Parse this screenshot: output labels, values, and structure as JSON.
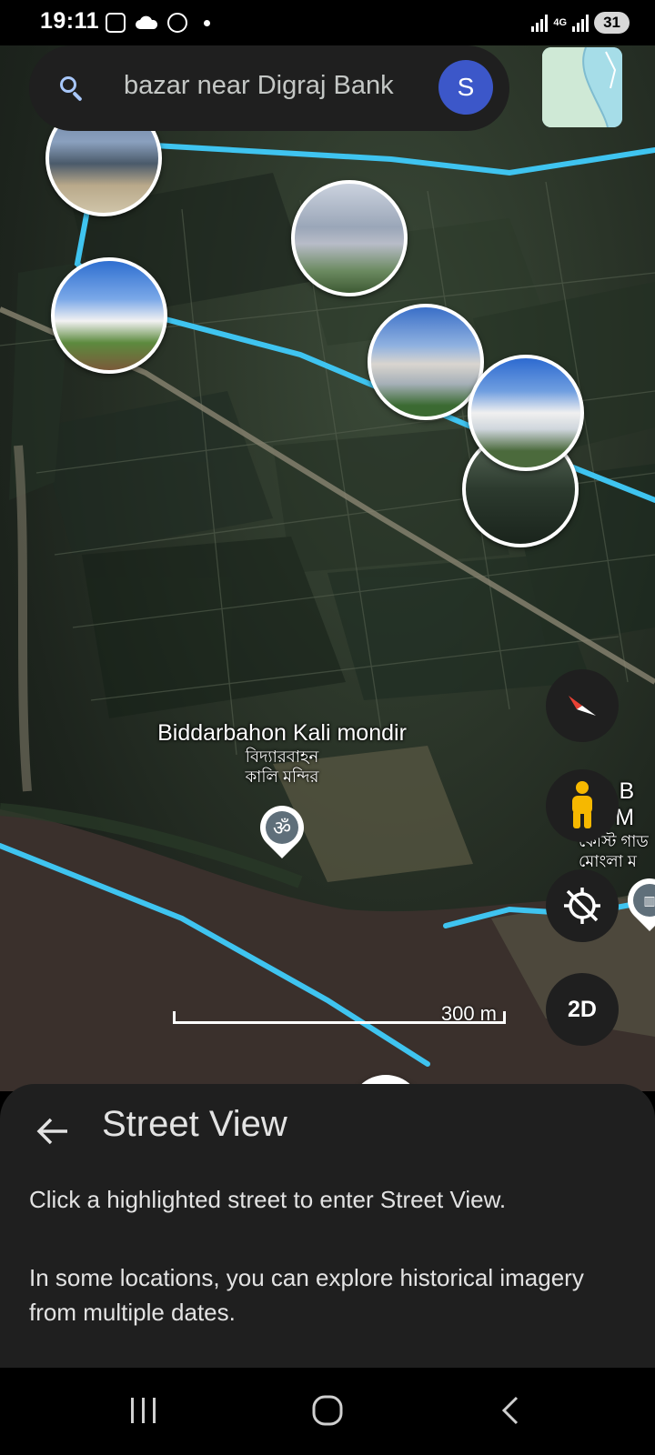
{
  "status_bar": {
    "time": "19:11",
    "network": "4G",
    "battery": "31"
  },
  "search": {
    "query": "bazar near Digraj Bank",
    "avatar_initial": "S",
    "icon": "search-icon"
  },
  "map": {
    "place": {
      "name_en": "Biddarbahon Kali mondir",
      "name_bn_line1": "বিদ্যারবাহন",
      "name_bn_line2": "কালি মন্দির",
      "icon": "om-icon"
    },
    "partial_label": {
      "line1_en": "CG B",
      "line2_en": "gla M",
      "line1_bn": "কোস্ট গাড",
      "line2_bn": "মোংলা ম"
    },
    "scale_label": "300 m",
    "controls": {
      "compass_icon": "compass-icon",
      "street_view_icon": "pegman-icon",
      "location_icon": "my-location-icon",
      "view_mode": "2D"
    }
  },
  "sheet": {
    "title": "Street View",
    "line1": "Click a highlighted street to enter Street View.",
    "line2": "In some locations, you can explore historical imagery from multiple dates."
  },
  "colors": {
    "street_highlight": "#3fc4f0",
    "panel_bg": "#1f1f1f",
    "avatar_bg": "#3c57c9",
    "pegman": "#f6b800"
  }
}
